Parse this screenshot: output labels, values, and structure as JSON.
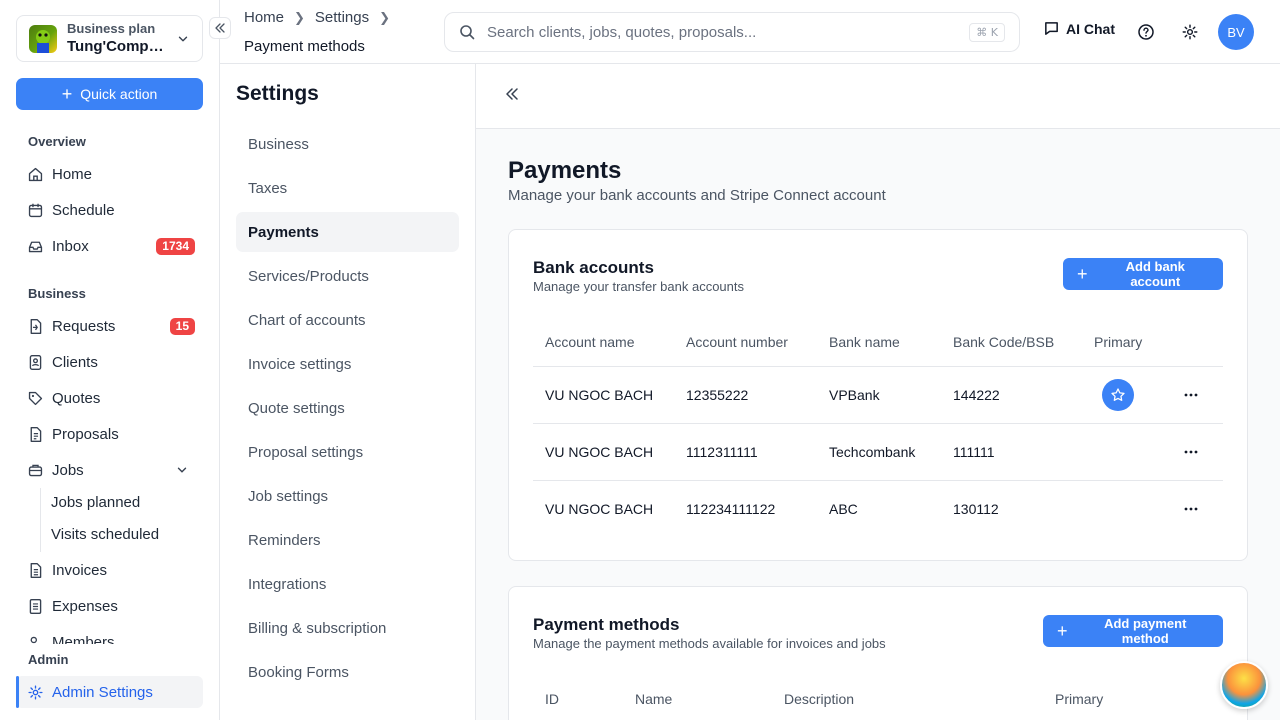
{
  "sidebar": {
    "business_plan": "Business plan",
    "business_name": "Tung'Company",
    "quick_action": "Quick action",
    "groups": {
      "overview": "Overview",
      "business": "Business",
      "admin": "Admin"
    },
    "items": {
      "home": "Home",
      "schedule": "Schedule",
      "inbox": "Inbox",
      "inbox_badge": "1734",
      "requests": "Requests",
      "requests_badge": "15",
      "clients": "Clients",
      "quotes": "Quotes",
      "proposals": "Proposals",
      "jobs": "Jobs",
      "jobs_planned": "Jobs planned",
      "visits_scheduled": "Visits scheduled",
      "invoices": "Invoices",
      "expenses": "Expenses",
      "members": "Members",
      "admin_settings": "Admin Settings"
    }
  },
  "topbar": {
    "breadcrumb": [
      "Home",
      "Settings"
    ],
    "current": "Payment methods",
    "search_placeholder": "Search clients, jobs, quotes, proposals...",
    "search_shortcut": "⌘ K",
    "ai_chat": "AI Chat",
    "avatar_initials": "BV"
  },
  "settings": {
    "title": "Settings",
    "items": [
      "Business",
      "Taxes",
      "Payments",
      "Services/Products",
      "Chart of accounts",
      "Invoice settings",
      "Quote settings",
      "Proposal settings",
      "Job settings",
      "Reminders",
      "Integrations",
      "Billing & subscription",
      "Booking Forms"
    ],
    "active": "Payments"
  },
  "main": {
    "title": "Payments",
    "subtitle": "Manage your bank accounts and Stripe Connect account",
    "bank_accounts": {
      "title": "Bank accounts",
      "subtitle": "Manage your transfer bank accounts",
      "add_label": "Add bank account",
      "columns": [
        "Account name",
        "Account number",
        "Bank name",
        "Bank Code/BSB",
        "Primary"
      ],
      "rows": [
        {
          "account_name": "VU NGOC BACH",
          "account_number": "12355222",
          "bank_name": "VPBank",
          "bank_code": "144222",
          "primary": true
        },
        {
          "account_name": "VU NGOC BACH",
          "account_number": "1112311111",
          "bank_name": "Techcombank",
          "bank_code": "111111",
          "primary": false
        },
        {
          "account_name": "VU NGOC BACH",
          "account_number": "112234111122",
          "bank_name": "ABC",
          "bank_code": "130112",
          "primary": false
        }
      ]
    },
    "payment_methods": {
      "title": "Payment methods",
      "subtitle": "Manage the payment methods available for invoices and jobs",
      "add_label": "Add payment method",
      "columns": [
        "ID",
        "Name",
        "Description",
        "Primary"
      ]
    }
  },
  "colors": {
    "accent": "#3b82f6",
    "badge": "#ef4444"
  }
}
